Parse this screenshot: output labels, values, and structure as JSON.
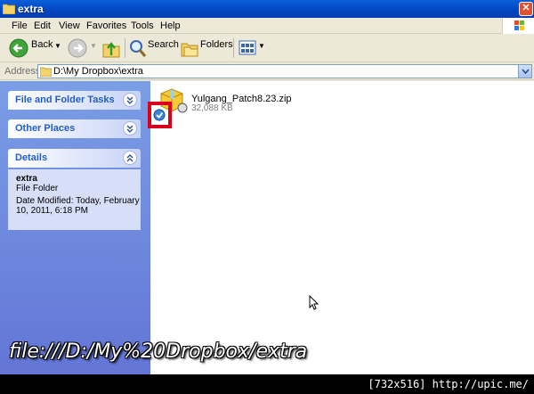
{
  "window": {
    "title": "extra"
  },
  "menu": [
    "File",
    "Edit",
    "View",
    "Favorites",
    "Tools",
    "Help"
  ],
  "toolbar": {
    "back_label": "Back",
    "search_label": "Search",
    "folders_label": "Folders"
  },
  "address": {
    "label": "Address",
    "path": "D:\\My Dropbox\\extra"
  },
  "taskpane": {
    "file_folder_tasks": "File and Folder Tasks",
    "other_places": "Other Places",
    "details": "Details",
    "details_name": "extra",
    "details_type": "File Folder",
    "details_date_line1": "Date Modified: Today, February",
    "details_date_line2": "10, 2011, 6:18 PM"
  },
  "file": {
    "name": "Yulgang_Patch8.23.zip",
    "size": "32,088 KB"
  },
  "overlay_url": "file:///D:/My%20Dropbox/extra",
  "caption": "[732x516] http://upic.me/",
  "colors": {
    "title_bar": "#0246c2",
    "task_pane": "#6375d6",
    "panel_title": "#215dc6",
    "highlight": "#d9001d"
  }
}
